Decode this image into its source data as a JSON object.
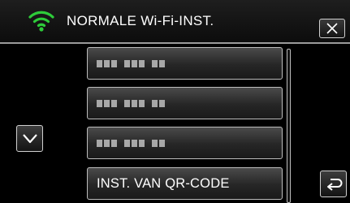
{
  "header": {
    "title": "NORMALE Wi-Fi-INST.",
    "wifi_icon": "wifi-icon",
    "close_icon": "close-icon",
    "accent_color": "#2ecc3a"
  },
  "list": {
    "items": [
      {
        "type": "masked-network-name"
      },
      {
        "type": "masked-network-name"
      },
      {
        "type": "masked-network-name"
      },
      {
        "type": "option",
        "label": "INST. VAN QR-CODE"
      }
    ]
  },
  "controls": {
    "scroll_down_icon": "chevron-down-icon",
    "back_icon": "back-arrow-icon"
  }
}
